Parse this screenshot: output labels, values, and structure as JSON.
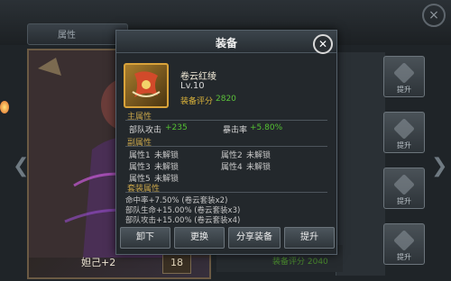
{
  "background": {
    "tab_label": "属性",
    "close_icon": "close-icon",
    "character_name": "妲己+2",
    "character_level": "18",
    "bg_item_score_text": "装备评分 2040",
    "slots": [
      {
        "label": "提升"
      },
      {
        "label": "提升"
      },
      {
        "label": "提升"
      },
      {
        "label": "提升"
      }
    ]
  },
  "modal": {
    "title": "装备",
    "close_icon": "close-icon",
    "item": {
      "name": "卷云红绫",
      "level": "Lv.10",
      "score_label": "装备评分",
      "score_value": "2820"
    },
    "main_attr_title": "主属性",
    "main_attrs": [
      {
        "label": "部队攻击",
        "value": "+235"
      },
      {
        "label": "暴击率",
        "value": "+5.80%"
      }
    ],
    "sub_attr_title": "副属性",
    "sub_attrs": [
      {
        "label": "属性1",
        "value": "未解锁"
      },
      {
        "label": "属性2",
        "value": "未解锁"
      },
      {
        "label": "属性3",
        "value": "未解锁"
      },
      {
        "label": "属性4",
        "value": "未解锁"
      },
      {
        "label": "属性5",
        "value": "未解锁"
      }
    ],
    "set_attr_title": "套装属性",
    "set_attrs": [
      "命中率+7.50%  (卷云套装x2)",
      "部队生命+15.00%  (卷云套装x3)",
      "部队攻击+15.00%  (卷云套装x4)"
    ],
    "buttons": {
      "unequip": "卸下",
      "replace": "更换",
      "share": "分享装备",
      "upgrade": "提升"
    }
  },
  "colors": {
    "accent_gold": "#c7a44a",
    "positive_green": "#54c032",
    "frame_orange": "#d9a33a"
  }
}
